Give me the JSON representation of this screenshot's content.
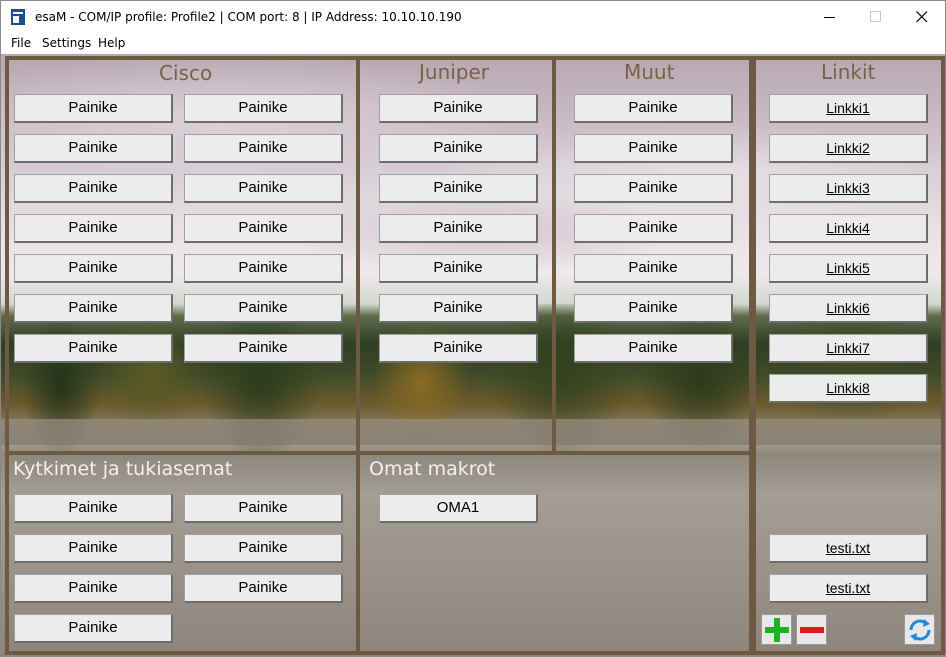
{
  "window": {
    "title": "esaM - COM/IP profile: Profile2 | COM port: 8 | IP Address: 10.10.10.190",
    "minimize_icon": "minimize-icon",
    "maximize_icon": "maximize-icon",
    "close_icon": "close-icon"
  },
  "menu": {
    "items": [
      "File",
      "Settings",
      "Help"
    ]
  },
  "panels": {
    "cisco": {
      "title": "Cisco",
      "buttons": [
        "Painike",
        "Painike",
        "Painike",
        "Painike",
        "Painike",
        "Painike",
        "Painike",
        "Painike",
        "Painike",
        "Painike",
        "Painike",
        "Painike",
        "Painike",
        "Painike"
      ]
    },
    "juniper": {
      "title": "Juniper",
      "buttons": [
        "Painike",
        "Painike",
        "Painike",
        "Painike",
        "Painike",
        "Painike",
        "Painike"
      ]
    },
    "muut": {
      "title": "Muut",
      "buttons": [
        "Painike",
        "Painike",
        "Painike",
        "Painike",
        "Painike",
        "Painike",
        "Painike"
      ]
    },
    "linkit": {
      "title": "Linkit",
      "links": [
        "Linkki1",
        "Linkki2",
        "Linkki3",
        "Linkki4",
        "Linkki5",
        "Linkki6",
        "Linkki7",
        "Linkki8"
      ],
      "files": [
        "testi.txt",
        "testi.txt"
      ]
    },
    "kytkimet": {
      "title": "Kytkimet ja tukiasemat",
      "buttons": [
        "Painike",
        "Painike",
        "Painike",
        "Painike",
        "Painike",
        "Painike",
        "Painike"
      ]
    },
    "omat": {
      "title": "Omat makrot",
      "buttons": [
        "OMA1"
      ]
    }
  },
  "toolbar": {
    "add_icon": "plus-icon",
    "remove_icon": "minus-icon",
    "refresh_icon": "refresh-icon"
  },
  "colors": {
    "frame": "#6e5a42",
    "title_text": "#7a6248",
    "add": "#1db31d",
    "remove": "#d81e1e",
    "refresh": "#1f8ad6"
  }
}
